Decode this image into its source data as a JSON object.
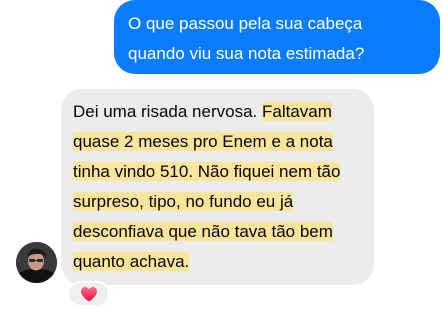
{
  "outgoing_message": {
    "lines": [
      "O que passou pela sua cabeça",
      "quando viu sua nota estimada?"
    ]
  },
  "incoming_message": {
    "line1_plain": "Dei uma risada nervosa. ",
    "line1_highlight": "Faltavam",
    "line2": "quase 2 meses pro Enem e a nota",
    "line3": "tinha vindo 510. Não fiquei nem tão",
    "line4": "surpreso, tipo, no fundo eu já",
    "line5": "desconfiava que não tava tão bem",
    "line6": "quanto achava."
  },
  "avatar": {
    "icon": "user-avatar-photo"
  },
  "reaction": {
    "icon": "heart-icon",
    "color": "#f02849"
  },
  "colors": {
    "outgoing_bubble": "#0a7cff",
    "incoming_bubble": "#ececed",
    "highlight": "#fbe59b"
  }
}
